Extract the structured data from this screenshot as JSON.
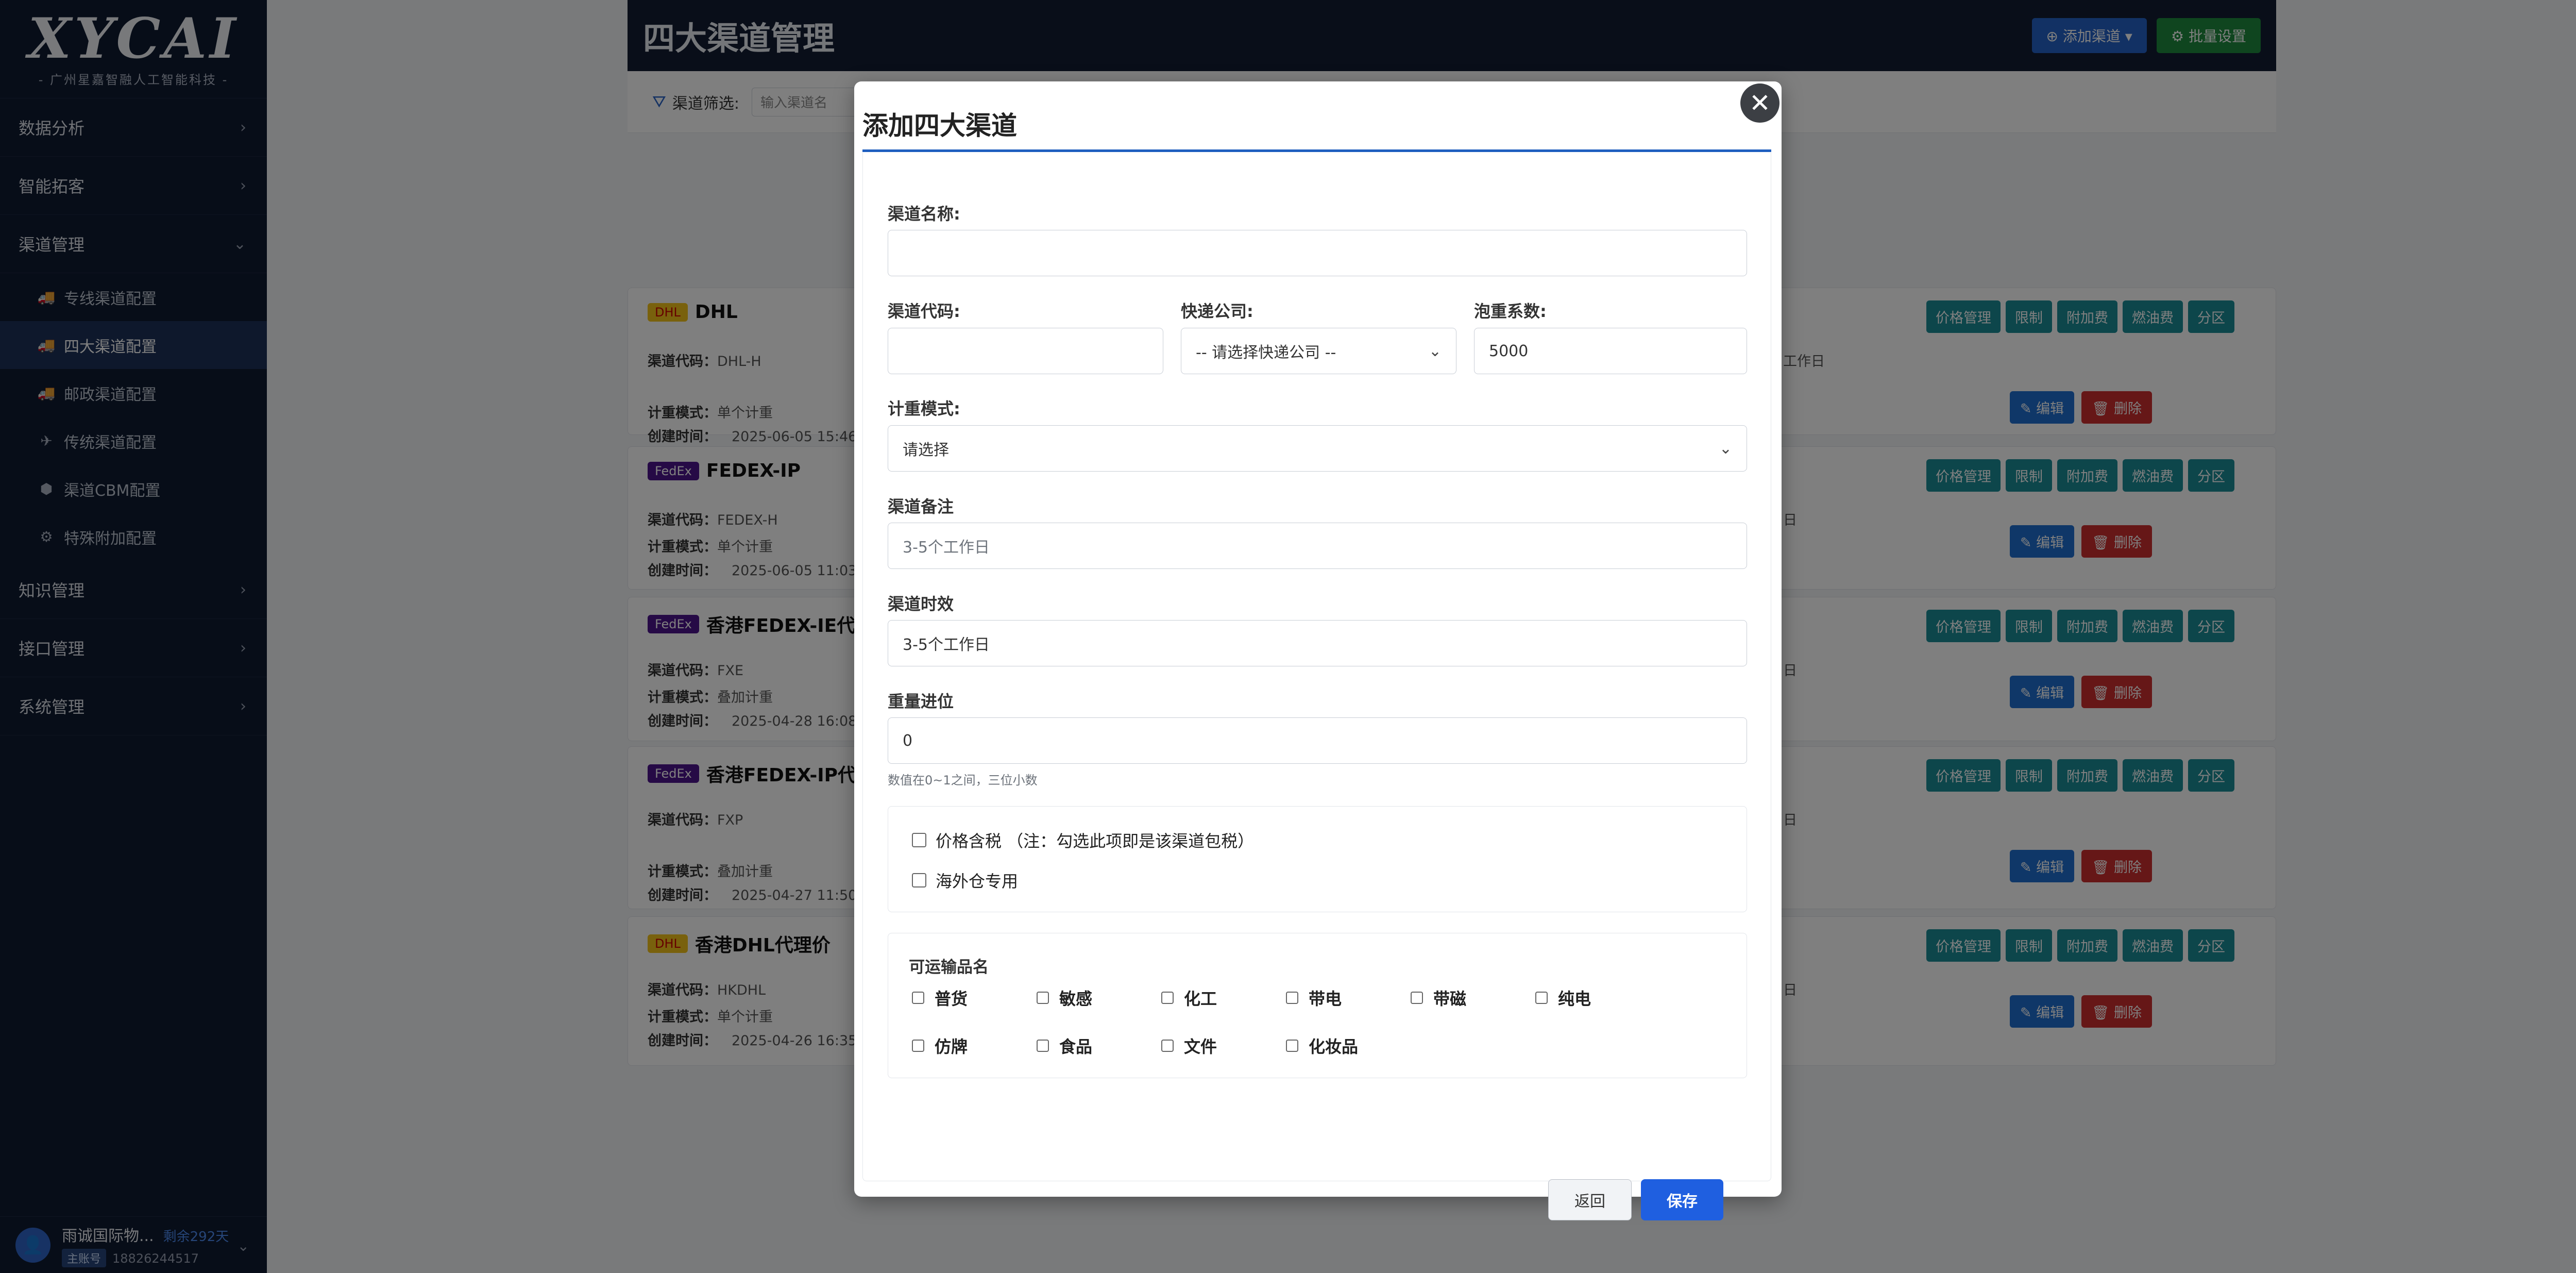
{
  "logo": {
    "mark": "XYCAI",
    "subtitle": "- 广州星嘉智融人工智能科技 -"
  },
  "sidebar": {
    "sections": [
      {
        "label": "数据分析"
      },
      {
        "label": "智能拓客"
      },
      {
        "label": "渠道管理"
      }
    ],
    "channel_items": [
      {
        "label": "专线渠道配置",
        "icon": "truck-icon"
      },
      {
        "label": "四大渠道配置",
        "icon": "truck-fast-icon",
        "active": true
      },
      {
        "label": "邮政渠道配置",
        "icon": "truck-icon"
      },
      {
        "label": "传统渠道配置",
        "icon": "plane-icon"
      },
      {
        "label": "渠道CBM配置",
        "icon": "box-icon"
      },
      {
        "label": "特殊附加配置",
        "icon": "gear-icon"
      }
    ],
    "sections_after": [
      {
        "label": "知识管理"
      },
      {
        "label": "接口管理"
      },
      {
        "label": "系统管理"
      }
    ],
    "user": {
      "name": "雨诚国际物...",
      "remaining": "剩余292天",
      "role": "主账号",
      "phone": "18826244517"
    }
  },
  "header": {
    "title": "四大渠道管理",
    "add_button": "添加渠道",
    "batch_button": "批量设置"
  },
  "filter": {
    "label": "渠道筛选:",
    "placeholder": "输入渠道名"
  },
  "cards": [
    {
      "badge": "DHL",
      "name": "DHL",
      "code": "DHL-H",
      "mode": "单个计重",
      "created": "2025-06-05 15:46",
      "extra": "工作日"
    },
    {
      "badge": "FedEx",
      "name": "FEDEX-IP",
      "code": "FEDEX-H",
      "mode": "单个计重",
      "created": "2025-06-05 11:03",
      "extra": "日"
    },
    {
      "badge": "FedEx",
      "name": "香港FEDEX-IE代",
      "code": "FXE",
      "mode": "叠加计重",
      "created": "2025-04-28 16:08",
      "extra": "日"
    },
    {
      "badge": "FedEx",
      "name": "香港FEDEX-IP代",
      "code": "FXP",
      "mode": "叠加计重",
      "created": "2025-04-27 11:50",
      "extra": "日"
    },
    {
      "badge": "DHL",
      "name": "香港DHL代理价",
      "code": "HKDHL",
      "mode": "单个计重",
      "created": "2025-04-26 16:35",
      "extra": "日"
    }
  ],
  "card_labels": {
    "code": "渠道代码：",
    "mode": "计重模式：",
    "created": "创建时间："
  },
  "card_actions": [
    "价格管理",
    "限制",
    "附加费",
    "燃油费",
    "分区"
  ],
  "card_edit": {
    "edit": "编辑",
    "delete": "删除"
  },
  "modal": {
    "title": "添加四大渠道",
    "close": "✕",
    "name_label": "渠道名称:",
    "name_value": "",
    "code_label": "渠道代码:",
    "code_value": "",
    "company_label": "快递公司:",
    "company_value": "-- 请选择快递公司 --",
    "bubble_label": "泡重系数:",
    "bubble_value": "5000",
    "mode_label": "计重模式:",
    "mode_value": "请选择",
    "remark_label": "渠道备注",
    "remark_placeholder": "3-5个工作日",
    "timeliness_label": "渠道时效",
    "timeliness_value": "3-5个工作日",
    "rounding_label": "重量进位",
    "rounding_value": "0",
    "rounding_hint": "数值在0~1之间，三位小数",
    "tax_label": "价格含税 （注：勾选此项即是该渠道包税）",
    "overseas_label": "海外仓专用",
    "goods_title": "可运输品名",
    "goods": [
      "普货",
      "敏感",
      "化工",
      "带电",
      "带磁",
      "纯电",
      "仿牌",
      "食品",
      "文件",
      "化妆品"
    ],
    "back_button": "返回",
    "save_button": "保存"
  }
}
